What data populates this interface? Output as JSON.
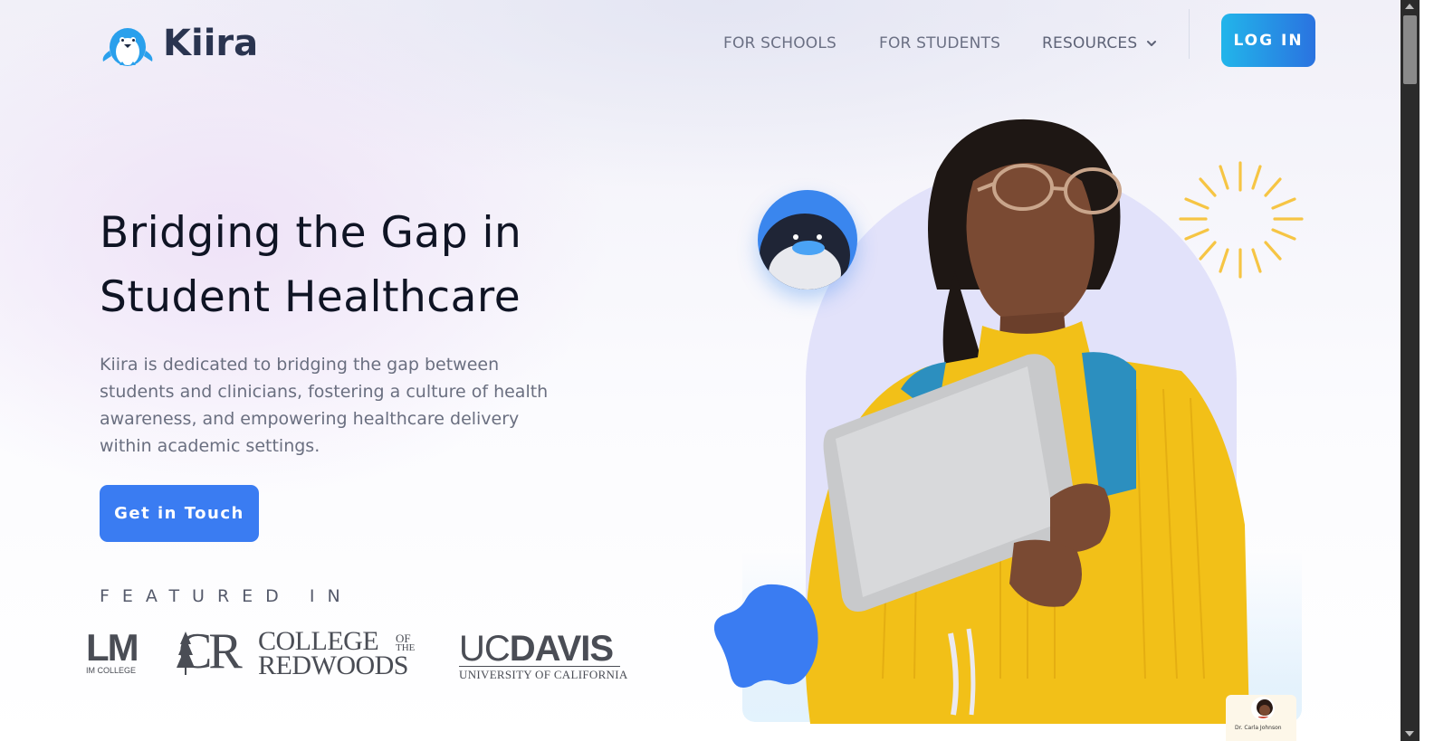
{
  "header": {
    "brand": "Kiira",
    "nav": {
      "for_schools": "FOR SCHOOLS",
      "for_students": "FOR STUDENTS",
      "resources": "RESOURCES"
    },
    "login_label": "LOG IN"
  },
  "hero": {
    "headline": "Bridging the Gap in Student Healthcare",
    "description": "Kiira is dedicated to bridging the gap between students and clinicians, fostering a culture of health awareness, and empowering healthcare delivery within academic settings.",
    "cta_label": "Get in Touch"
  },
  "featured": {
    "label": "FEATURED IN",
    "logos": {
      "lm_big": "LM",
      "lm_small": "IM COLLEGE",
      "cr_mark": "CR",
      "cr_line1": "COLLEGE",
      "cr_of": "OF",
      "cr_the": "THE",
      "cr_line2": "REDWOODS",
      "ucd_uc": "UC",
      "ucd_davis": "DAVIS",
      "ucd_sub": "UNIVERSITY OF CALIFORNIA"
    }
  },
  "visual": {
    "doctor_card_name": "Dr. Carla Johnson"
  },
  "colors": {
    "brand_blue": "#3a7cf2",
    "login_gradient_start": "#22b5ea",
    "login_gradient_end": "#2a73e0",
    "arch": "#e2e2fa",
    "sun": "#f6c544",
    "headline": "#0f1424"
  }
}
